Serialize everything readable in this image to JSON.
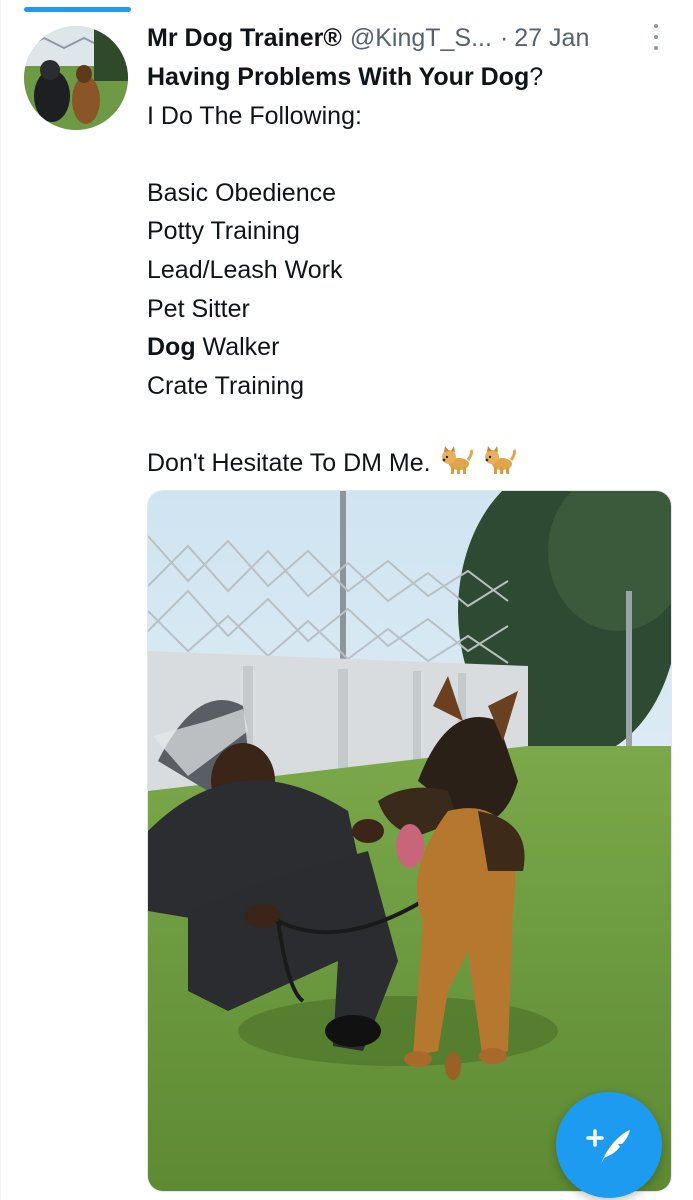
{
  "tweet": {
    "author_name": "Mr Dog Trainer®",
    "author_handle": "@KingT_S...",
    "separator": "·",
    "date": "27 Jan",
    "lines": {
      "l1": "Having Problems With Your Dog?",
      "l2": "I Do The Following:",
      "l4": "Basic Obedience",
      "l5": "Potty Training",
      "l6": "Lead/Leash Work",
      "l7": "Pet Sitter",
      "l8_bold": "Dog",
      "l8_rest": " Walker",
      "l9": "Crate Training",
      "l11": "Don't Hesitate To DM Me."
    },
    "emojis": [
      "dog-emoji",
      "dog-emoji"
    ]
  },
  "colors": {
    "accent": "#1d9bf0",
    "text": "#0f1419",
    "secondary_text": "#536471"
  },
  "icons": {
    "more": "more-vertical-icon",
    "compose": "compose-tweet-icon"
  }
}
